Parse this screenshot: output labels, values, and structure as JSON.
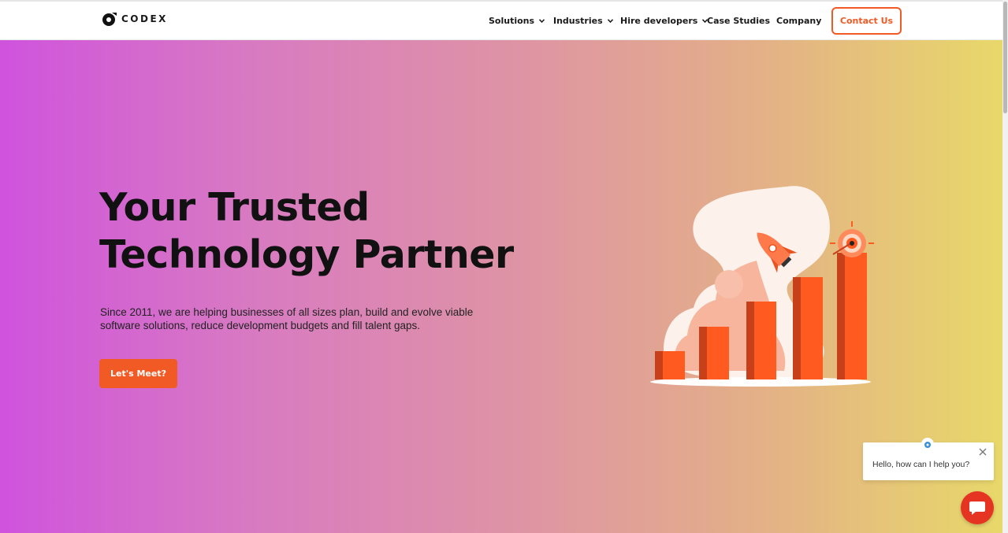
{
  "brand": {
    "name": "CODEX",
    "accent": "#f15a24"
  },
  "nav": {
    "items": [
      {
        "label": "Solutions",
        "has_dropdown": true
      },
      {
        "label": "Industries",
        "has_dropdown": true
      },
      {
        "label": "Hire developers",
        "has_dropdown": true
      },
      {
        "label": "Case Studies",
        "has_dropdown": false
      },
      {
        "label": "Company",
        "has_dropdown": false
      }
    ],
    "contact_label": "Contact Us"
  },
  "hero": {
    "headline_line1": "Your Trusted",
    "headline_line2": "Technology Partner",
    "subtext": "Since 2011, we are helping businesses of all sizes plan, build and evolve viable software solutions, reduce development budgets and fill talent gaps.",
    "cta_label": "Let's Meet?",
    "illustration": "rocket-growth-chart-illustration"
  },
  "chat": {
    "message": "Hello, how can I help you?",
    "close_icon": "close-icon",
    "launcher_icon": "chat-icon"
  }
}
